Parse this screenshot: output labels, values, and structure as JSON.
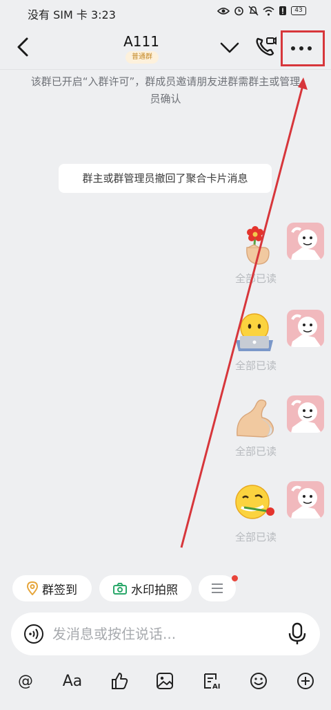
{
  "status_bar": {
    "left_text": "没有 SIM 卡 3:23",
    "battery": "43"
  },
  "header": {
    "title": "A111",
    "badge": "普通群"
  },
  "notice": {
    "permission": "该群已开启“入群许可”，群成员邀请朋友进群需群主或管理员确认",
    "recall": "群主或群管理员撤回了聚合卡片消息"
  },
  "messages": [
    {
      "sticker": "hand-holding-flower",
      "read_status": "全部已读"
    },
    {
      "sticker": "face-with-laptop",
      "read_status": "全部已读"
    },
    {
      "sticker": "flexed-biceps",
      "read_status": "全部已读"
    },
    {
      "sticker": "smirk-face-with-rose",
      "read_status": "全部已读"
    }
  ],
  "quick_actions": {
    "sign_in": "群签到",
    "watermark_photo": "水印拍照"
  },
  "input": {
    "placeholder": "发消息或按住说话..."
  },
  "toolbar": {
    "at": "@",
    "font": "Aa"
  },
  "colors": {
    "background": "#eeeff1",
    "annotation": "#d7363b",
    "badge_text": "#c58a2a",
    "unread_dot": "#e8443a",
    "avatar": "#f1b9bd"
  }
}
